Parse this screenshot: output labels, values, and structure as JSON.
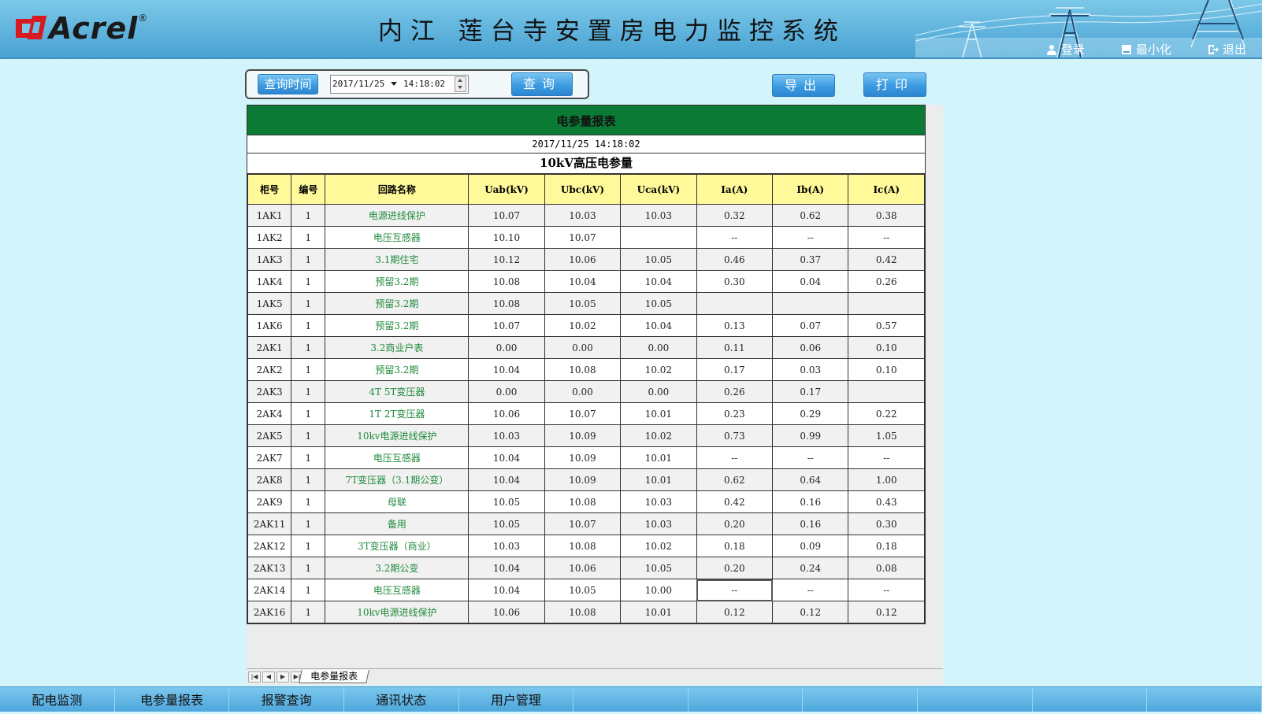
{
  "header": {
    "logo_text": "Acrel",
    "logo_reg": "®",
    "system_title": "内江 莲台寺安置房电力监控系统",
    "buttons": {
      "login": "登录",
      "minimize": "最小化",
      "exit": "退出"
    }
  },
  "query": {
    "time_label": "查询时间",
    "date": "2017/11/25",
    "time": "14:18:02",
    "query_label": "查询",
    "export_label": "导出",
    "print_label": "打印"
  },
  "report": {
    "title": "电参量报表",
    "timestamp": "2017/11/25 14:18:02",
    "subtitle": "10kV高压电参量",
    "columns": [
      "柜号",
      "编号",
      "回路名称",
      "Uab(kV)",
      "Ubc(kV)",
      "Uca(kV)",
      "Ia(A)",
      "Ib(A)",
      "Ic(A)"
    ],
    "rows": [
      [
        "1AK1",
        "1",
        "电源进线保护",
        "10.07",
        "10.03",
        "10.03",
        "0.32",
        "0.62",
        "0.38"
      ],
      [
        "1AK2",
        "1",
        "电压互感器",
        "10.10",
        "10.07",
        "",
        "--",
        "--",
        "--"
      ],
      [
        "1AK3",
        "1",
        "3.1期住宅",
        "10.12",
        "10.06",
        "10.05",
        "0.46",
        "0.37",
        "0.42"
      ],
      [
        "1AK4",
        "1",
        "预留3.2期",
        "10.08",
        "10.04",
        "10.04",
        "0.30",
        "0.04",
        "0.26"
      ],
      [
        "1AK5",
        "1",
        "预留3.2期",
        "10.08",
        "10.05",
        "10.05",
        "",
        "",
        ""
      ],
      [
        "1AK6",
        "1",
        "预留3.2期",
        "10.07",
        "10.02",
        "10.04",
        "0.13",
        "0.07",
        "0.57"
      ],
      [
        "2AK1",
        "1",
        "3.2商业户表",
        "0.00",
        "0.00",
        "0.00",
        "0.11",
        "0.06",
        "0.10"
      ],
      [
        "2AK2",
        "1",
        "预留3.2期",
        "10.04",
        "10.08",
        "10.02",
        "0.17",
        "0.03",
        "0.10"
      ],
      [
        "2AK3",
        "1",
        "4T 5T变压器",
        "0.00",
        "0.00",
        "0.00",
        "0.26",
        "0.17",
        ""
      ],
      [
        "2AK4",
        "1",
        "1T 2T变压器",
        "10.06",
        "10.07",
        "10.01",
        "0.23",
        "0.29",
        "0.22"
      ],
      [
        "2AK5",
        "1",
        "10kv电源进线保护",
        "10.03",
        "10.09",
        "10.02",
        "0.73",
        "0.99",
        "1.05"
      ],
      [
        "2AK7",
        "1",
        "电压互感器",
        "10.04",
        "10.09",
        "10.01",
        "--",
        "--",
        "--"
      ],
      [
        "2AK8",
        "1",
        "7T变压器（3.1期公变）",
        "10.04",
        "10.09",
        "10.01",
        "0.62",
        "0.64",
        "1.00"
      ],
      [
        "2AK9",
        "1",
        "母联",
        "10.05",
        "10.08",
        "10.03",
        "0.42",
        "0.16",
        "0.43"
      ],
      [
        "2AK11",
        "1",
        "备用",
        "10.05",
        "10.07",
        "10.03",
        "0.20",
        "0.16",
        "0.30"
      ],
      [
        "2AK12",
        "1",
        "3T变压器（商业）",
        "10.03",
        "10.08",
        "10.02",
        "0.18",
        "0.09",
        "0.18"
      ],
      [
        "2AK13",
        "1",
        "3.2期公变",
        "10.04",
        "10.06",
        "10.05",
        "0.20",
        "0.24",
        "0.08"
      ],
      [
        "2AK14",
        "1",
        "电压互感器",
        "10.04",
        "10.05",
        "10.00",
        "--",
        "--",
        "--"
      ],
      [
        "2AK16",
        "1",
        "10kv电源进线保护",
        "10.06",
        "10.08",
        "10.01",
        "0.12",
        "0.12",
        "0.12"
      ]
    ],
    "sheet_tab": "电参量报表"
  },
  "nav": {
    "items": [
      "配电监测",
      "电参量报表",
      "报警查询",
      "通讯状态",
      "用户管理",
      "",
      "",
      "",
      "",
      "",
      ""
    ]
  },
  "colors": {
    "title_bar": "#0b7a35",
    "header_row": "#fff99a",
    "name_text": "#1f8a3b",
    "page_bg": "#d3f4fb"
  }
}
